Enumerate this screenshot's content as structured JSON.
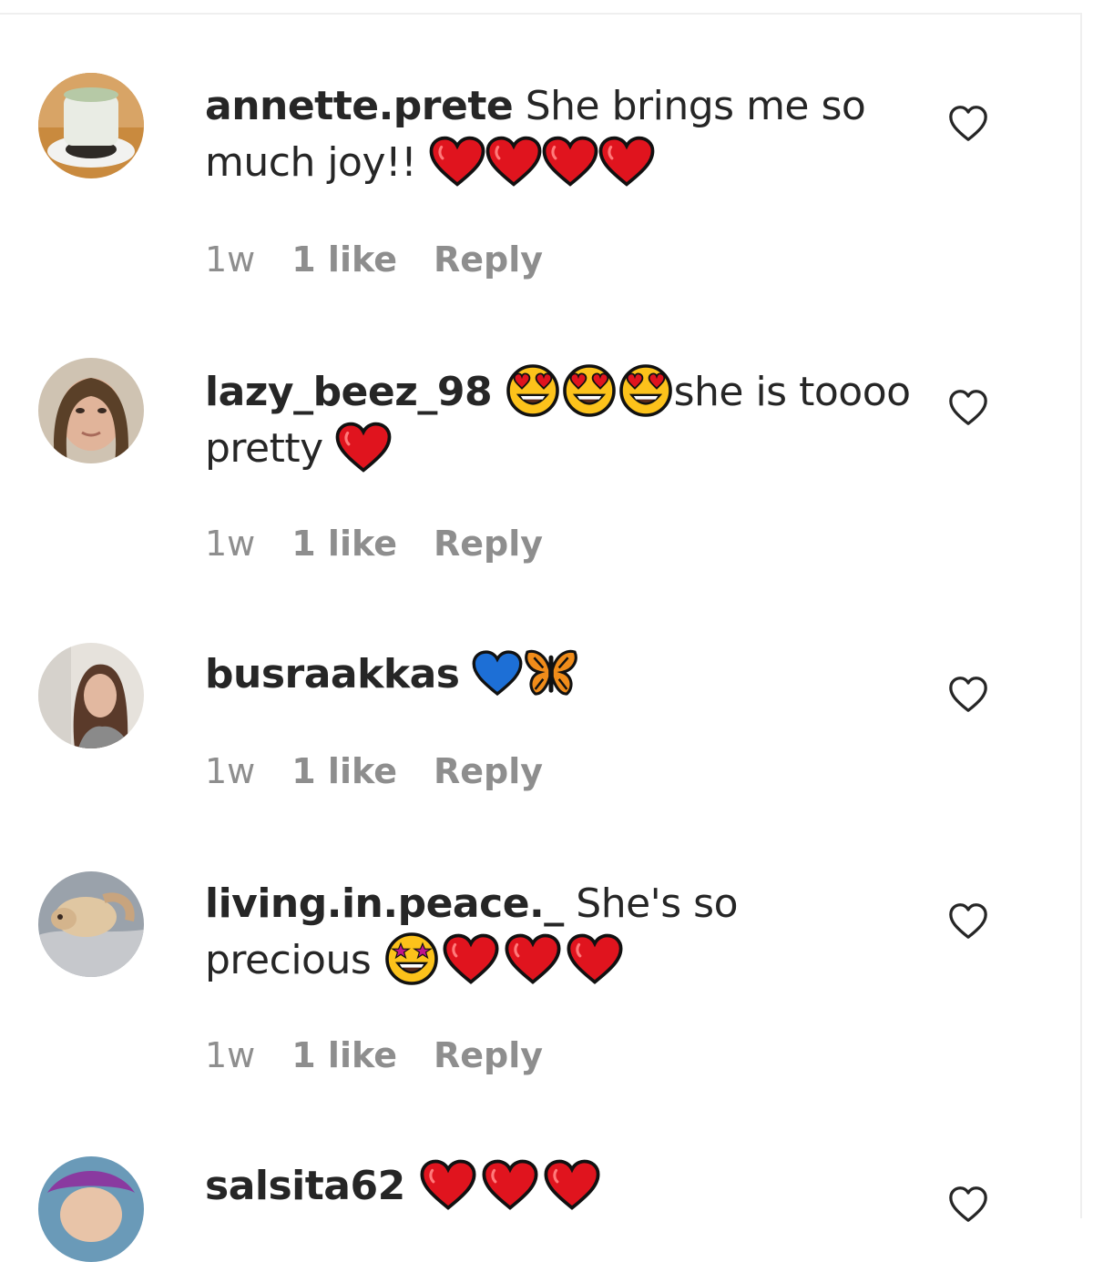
{
  "colors": {
    "text": "#262626",
    "meta": "#8e8e8e",
    "heart_red": "#e0141e",
    "heart_blue": "#1d6fd6"
  },
  "comments": [
    {
      "username": "annette.prete",
      "text": "She brings me so much joy!!",
      "emojis": [
        "red-heart",
        "red-heart",
        "red-heart",
        "red-heart"
      ],
      "time": "1w",
      "likes": "1 like",
      "reply": "Reply"
    },
    {
      "username": "lazy_beez_98",
      "emojis_before": [
        "heart-eyes-face",
        "heart-eyes-face",
        "heart-eyes-face"
      ],
      "text": "she is toooo pretty",
      "emojis": [
        "red-heart"
      ],
      "time": "1w",
      "likes": "1 like",
      "reply": "Reply"
    },
    {
      "username": "busraakkas",
      "emojis": [
        "blue-heart",
        "butterfly"
      ],
      "time": "1w",
      "likes": "1 like",
      "reply": "Reply"
    },
    {
      "username": "living.in.peace._",
      "text": "She's so precious",
      "emojis": [
        "star-struck-face",
        "red-heart",
        "red-heart",
        "red-heart"
      ],
      "time": "1w",
      "likes": "1 like",
      "reply": "Reply"
    },
    {
      "username": "salsita62",
      "emojis": [
        "red-heart",
        "red-heart",
        "red-heart"
      ]
    }
  ]
}
